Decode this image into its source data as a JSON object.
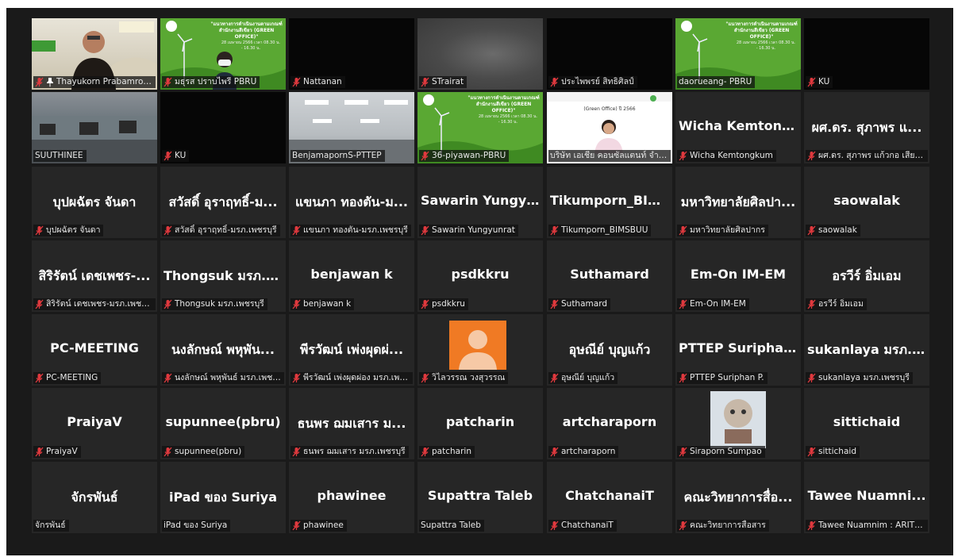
{
  "grid": {
    "tiles": [
      {
        "id": "t1",
        "big": "",
        "label": "Thayukorn Prabamroo...",
        "muted": true,
        "pinned": true,
        "video": "person-office",
        "active": true
      },
      {
        "id": "t2",
        "big": "",
        "label": "มธุรส ปราบไพรี PBRU",
        "muted": true,
        "video": "presentation-person"
      },
      {
        "id": "t3",
        "big": "",
        "label": "Nattanan",
        "muted": true,
        "video": "black"
      },
      {
        "id": "t4",
        "big": "",
        "label": "STrairat",
        "muted": true,
        "video": "blurry"
      },
      {
        "id": "t5",
        "big": "",
        "label": "ประไพพรย์ สิทธิศิลป์",
        "muted": true,
        "video": "black"
      },
      {
        "id": "t6",
        "big": "",
        "label": "daorueang- PBRU",
        "muted": false,
        "video": "presentation"
      },
      {
        "id": "t7",
        "big": "",
        "label": "KU",
        "muted": true,
        "video": "black"
      },
      {
        "id": "t8",
        "big": "",
        "label": "SUUTHINEE",
        "muted": false,
        "video": "office"
      },
      {
        "id": "t9",
        "big": "",
        "label": "KU",
        "muted": true,
        "video": "black"
      },
      {
        "id": "t10",
        "big": "",
        "label": "BenjamapornS-PTTEP",
        "muted": false,
        "video": "ceiling"
      },
      {
        "id": "t11",
        "big": "",
        "label": "36-piyawan-PBRU",
        "muted": true,
        "video": "presentation"
      },
      {
        "id": "t12",
        "big": "",
        "label": "บริษัท เอเชีย คอนซัลแตนท์ จำกัด",
        "muted": false,
        "video": "slide-person"
      },
      {
        "id": "t13",
        "big": "Wicha  Kemtong...",
        "label": "Wicha Kemtongkum",
        "muted": true
      },
      {
        "id": "t14",
        "big": "ผศ.ดร. สุภาพร แ...",
        "label": "ผศ.ดร. สุภาพร แก้วกอ เสียวไ...",
        "muted": true
      },
      {
        "id": "t15",
        "big": "บุปผฉัตร จันดา",
        "label": "บุปผฉัตร จันดา",
        "muted": true
      },
      {
        "id": "t16",
        "big": "สวัสดิ์ อุราฤทธิ์-ม...",
        "label": "สวัสดิ์ อุราฤทธิ์-มรภ.เพชรบุรี",
        "muted": true
      },
      {
        "id": "t17",
        "big": "แขนภา ทองตัน-ม...",
        "label": "แขนภา ทองตัน-มรภ.เพชรบุรี",
        "muted": true
      },
      {
        "id": "t18",
        "big": "Sawarin  Yungyu...",
        "label": "Sawarin Yungyunrat",
        "muted": true
      },
      {
        "id": "t19",
        "big": "Tikumporn_BIM...",
        "label": "Tikumporn_BIMSBUU",
        "muted": true
      },
      {
        "id": "t20",
        "big": "มหาวิทยาลัยศิลปา...",
        "label": "มหาวิทยาลัยศิลปากร",
        "muted": true
      },
      {
        "id": "t21",
        "big": "saowalak",
        "label": "saowalak",
        "muted": true
      },
      {
        "id": "t22",
        "big": "สิริรัตน์ เดชเพชร-...",
        "label": "สิริรัตน์ เดชเพชร-มรภ.เพชรบุรี",
        "muted": true
      },
      {
        "id": "t23",
        "big": "Thongsuk มรภ.เ...",
        "label": "Thongsuk มรภ.เพชรบุรี",
        "muted": true
      },
      {
        "id": "t24",
        "big": "benjawan  k",
        "label": "benjawan  k",
        "muted": true
      },
      {
        "id": "t25",
        "big": "psdkkru",
        "label": "psdkkru",
        "muted": true
      },
      {
        "id": "t26",
        "big": "Suthamard",
        "label": "Suthamard",
        "muted": true
      },
      {
        "id": "t27",
        "big": "Em-On IM-EM",
        "label": "Em-On IM-EM",
        "muted": true
      },
      {
        "id": "t28",
        "big": "อรวีร์ อิ่มเอม",
        "label": "อรวีร์ อิ่มเอม",
        "muted": true
      },
      {
        "id": "t29",
        "big": "PC-MEETING",
        "label": "PC-MEETING",
        "muted": true
      },
      {
        "id": "t30",
        "big": "นงลักษณ์ พหุพัน...",
        "label": "นงลักษณ์ พหุพันธ์ มรภ.เพชร...",
        "muted": true
      },
      {
        "id": "t31",
        "big": "พีรวัฒน์ เพ่งผุดผ่...",
        "label": "พีรวัฒน์ เพ่งผุดผ่อง มรภ.เพช...",
        "muted": true
      },
      {
        "id": "t32",
        "big": "",
        "label": "วิไลวรรณ วงสุวรรณ",
        "muted": true,
        "video": "avatar"
      },
      {
        "id": "t33",
        "big": "อุษณีย์ บุญแก้ว",
        "label": "อุษณีย์ บุญแก้ว",
        "muted": true
      },
      {
        "id": "t34",
        "big": "PTTEP Suriphan P.",
        "label": "PTTEP Suriphan P.",
        "muted": true
      },
      {
        "id": "t35",
        "big": "sukanlaya มรภ.เ...",
        "label": "sukanlaya มรภ.เพชรบุรี",
        "muted": true
      },
      {
        "id": "t36",
        "big": "PraiyaV",
        "label": "PraiyaV",
        "muted": true
      },
      {
        "id": "t37",
        "big": "supunnee(pbru)",
        "label": "supunnee(pbru)",
        "muted": true
      },
      {
        "id": "t38",
        "big": "ธนพร  ฌมเสาร ม...",
        "label": "ธนพร ฌมเสาร มรภ.เพชรบุรี",
        "muted": true
      },
      {
        "id": "t39",
        "big": "patcharin",
        "label": "patcharin",
        "muted": true
      },
      {
        "id": "t40",
        "big": "artcharaporn",
        "label": "artcharaporn",
        "muted": true
      },
      {
        "id": "t41",
        "big": "",
        "label": "Siraporn Sumpao",
        "muted": true,
        "video": "photo"
      },
      {
        "id": "t42",
        "big": "sittichaid",
        "label": "sittichaid",
        "muted": true
      },
      {
        "id": "t43",
        "big": "จักรพันธ์",
        "label": "จักรพันธ์",
        "muted": false
      },
      {
        "id": "t44",
        "big": "iPad ของ Suriya",
        "label": "iPad ของ Suriya",
        "muted": false
      },
      {
        "id": "t45",
        "big": "phawinee",
        "label": "phawinee",
        "muted": true
      },
      {
        "id": "t46",
        "big": "Supattra Taleb",
        "label": "Supattra Taleb",
        "muted": false
      },
      {
        "id": "t47",
        "big": "ChatchanaiT",
        "label": "ChatchanaiT",
        "muted": true
      },
      {
        "id": "t48",
        "big": "คณะวิทยาการสื่อ...",
        "label": "คณะวิทยาการสื่อสาร",
        "muted": true
      },
      {
        "id": "t49",
        "big": "Tawee  Nuamni...",
        "label": "Tawee Nuamnim : ARIT P...",
        "muted": true
      }
    ]
  },
  "presentation": {
    "title": "\"แนวทางการดำเนินงานตามเกณฑ์ สำนักงานสีเขียว (GREEN OFFICE)\"",
    "date": "28 เมษายน 2566 เวลา 08.30 น. - 16.30 น.",
    "logo": "PBRU",
    "slide_caption": "(Green Office) ปี 2566"
  },
  "colors": {
    "muted_icon": "#e0393e",
    "active_speaker": "#e6d36a",
    "tile_bg": "#262626",
    "frame_bg": "#1a1a1a"
  }
}
